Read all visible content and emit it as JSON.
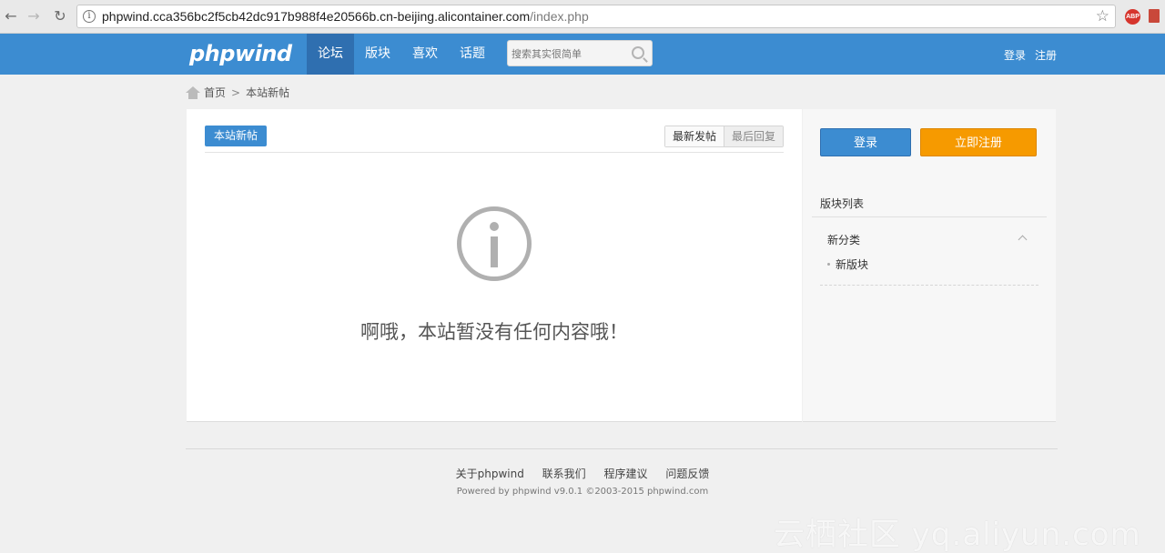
{
  "browser": {
    "url_host": "phpwind.cca356bc2f5cb42dc917b988f4e20566b.cn-beijing.alicontainer.com",
    "url_path": "/index.php",
    "abp_label": "ABP",
    "icons": {
      "back": "arrow-left-icon",
      "forward": "arrow-right-icon",
      "reload": "reload-icon",
      "info": "info-icon",
      "bookmark": "star-icon",
      "adblock": "adblock-icon"
    }
  },
  "header": {
    "logo": "phpwind",
    "nav": [
      {
        "label": "论坛",
        "active": true
      },
      {
        "label": "版块",
        "active": false
      },
      {
        "label": "喜欢",
        "active": false
      },
      {
        "label": "话题",
        "active": false
      }
    ],
    "search_placeholder": "搜索其实很简单",
    "login": "登录",
    "register": "注册",
    "colors": {
      "bar": "#3c8cd1",
      "active": "#2f6fb0"
    }
  },
  "breadcrumb": {
    "home": "首页",
    "separator": ">",
    "current": "本站新帖"
  },
  "main": {
    "section_tag": "本站新帖",
    "sort_tabs": [
      "最新发帖",
      "最后回复"
    ],
    "empty_message": "啊哦，本站暂没有任何内容哦！"
  },
  "sidebar": {
    "login_button": "登录",
    "register_button": "立即注册",
    "forum_list_title": "版块列表",
    "category": "新分类",
    "forum_item": "新版块",
    "colors": {
      "login": "#3c8cd1",
      "register": "#f69a00"
    }
  },
  "footer": {
    "links": [
      "关于phpwind",
      "联系我们",
      "程序建议",
      "问题反馈"
    ],
    "powered": "Powered by phpwind v9.0.1 ©2003-2015 phpwind.com"
  },
  "watermark": "云栖社区 yq.aliyun.com"
}
